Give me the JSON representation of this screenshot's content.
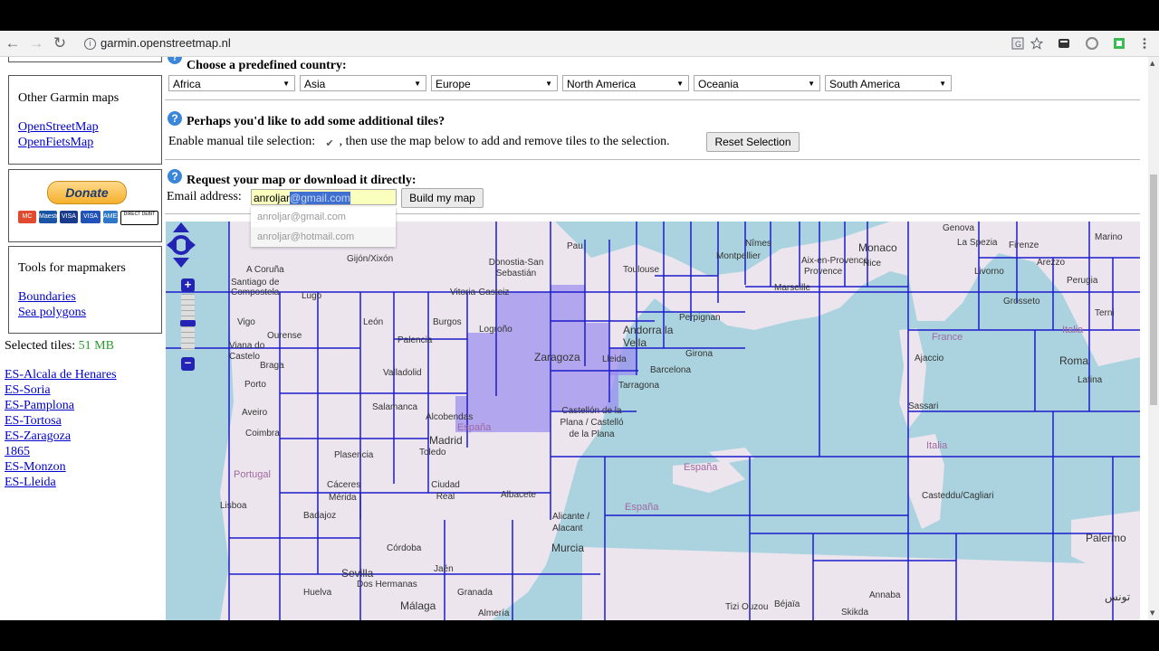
{
  "browser": {
    "url": "garmin.openstreetmap.nl"
  },
  "sidebar": {
    "other_maps": {
      "title": "Other Garmin maps",
      "links": [
        "OpenStreetMap",
        "OpenFietsMap"
      ]
    },
    "donate": {
      "button_label": "Donate",
      "payment_cards": [
        "MC",
        "Maestro",
        "VISA",
        "VISA",
        "AMEX",
        "DIRECT DEBIT"
      ]
    },
    "tools": {
      "title": "Tools for mapmakers",
      "links": [
        "Boundaries",
        "Sea polygons"
      ]
    },
    "selected_tiles": {
      "label": "Selected tiles:",
      "value": "51 MB"
    },
    "tile_list": [
      "ES-Alcala de Henares",
      "ES-Soria",
      "ES-Pamplona",
      "ES-Tortosa",
      "ES-Zaragoza",
      "1865",
      "ES-Monzon",
      "ES-Lleida"
    ]
  },
  "main": {
    "predefined": {
      "heading": "Choose a predefined country:",
      "selects": [
        "Africa",
        "Asia",
        "Europe",
        "North America",
        "Oceania",
        "South America"
      ]
    },
    "additional": {
      "heading": "Perhaps you'd like to add some additional tiles?",
      "label_before": "Enable manual tile selection:",
      "checkbox_checked": true,
      "label_after": ", then use the map below to add and remove tiles to the selection.",
      "reset_button": "Reset Selection"
    },
    "request": {
      "heading": "Request your map or download it directly:",
      "email_label": "Email address:",
      "email_typed": "anroljar",
      "email_autocomplete": "@gmail.com",
      "suggestions": [
        "anroljar@gmail.com",
        "anroljar@hotmail.com"
      ],
      "build_button": "Build my map"
    }
  },
  "map": {
    "labels": {
      "genova": "Genova",
      "monaco": "Monaco",
      "nice": "Nice",
      "marseille": "Marseille",
      "toulouse": "Toulouse",
      "montpellier": "Montpellier",
      "nimes": "Nîmes",
      "perpignan": "Perpignan",
      "andorra": "Andorra la Vella",
      "girona": "Girona",
      "barcelona": "Barcelona",
      "tarragona": "Tarragona",
      "lleida": "Lleida",
      "zaragoza": "Zaragoza",
      "logrono": "Logroño",
      "vitoria": "Vitoria-Gasteiz",
      "donostia": "Donostia-San Sebastián",
      "pau": "Pau",
      "gijon": "Gijón/Xixón",
      "acoruna": "A Coruña",
      "santiago": "Santiago de Compostela",
      "lugo": "Lugo",
      "vigo": "Vigo",
      "ourense": "Ourense",
      "vianadocastelo": "Viana do Castelo",
      "braga": "Braga",
      "porto": "Porto",
      "aveiro": "Aveiro",
      "coimbra": "Coimbra",
      "portugal": "Portugal",
      "lisboa": "Lisboa",
      "leon": "León",
      "burgos": "Burgos",
      "palencia": "Palencia",
      "valladolid": "Valladolid",
      "salamanca": "Salamanca",
      "madrid": "Madrid",
      "alcobendas": "Alcobendas",
      "espana1": "España",
      "toledo": "Toledo",
      "plasencia": "Plasencia",
      "caceres": "Cáceres",
      "merida": "Mérida",
      "badajoz": "Badajoz",
      "ciudadreal": "Ciudad Real",
      "albacete": "Albacete",
      "castellon": "Castellón de la Plana / Castelló de la Plana",
      "espana2": "España",
      "espana3": "España",
      "alicante": "Alicante / Alacant",
      "murcia": "Murcia",
      "cordoba": "Córdoba",
      "sevilla": "Sevilla",
      "jaen": "Jaén",
      "huelva": "Huelva",
      "malaga": "Málaga",
      "doshermanas": "Dos Hermanas",
      "almeria": "Almería",
      "granada": "Granada",
      "france": "France",
      "ajaccio": "Ajaccio",
      "sassari": "Sassari",
      "italia1": "Italia",
      "italia2": "Italia",
      "cagliari": "Casteddu/Cagliari",
      "firenze": "Firenze",
      "livorno": "Livorno",
      "laspezia": "La Spezia",
      "arezzo": "Arezzo",
      "perugia": "Perugia",
      "roma": "Roma",
      "latina": "Latina",
      "terni": "Terni",
      "grosseto": "Grosseto",
      "palermo": "Palermo",
      "annaba": "Annaba",
      "skikda": "Skikda",
      "bejaia": "Béjaïa",
      "tiziouzou": "Tizi Ouzou",
      "tunis": "تونس",
      "marino": "Marino",
      "aixen": "Aix-en-Provence",
      "provence": "Provence"
    }
  }
}
